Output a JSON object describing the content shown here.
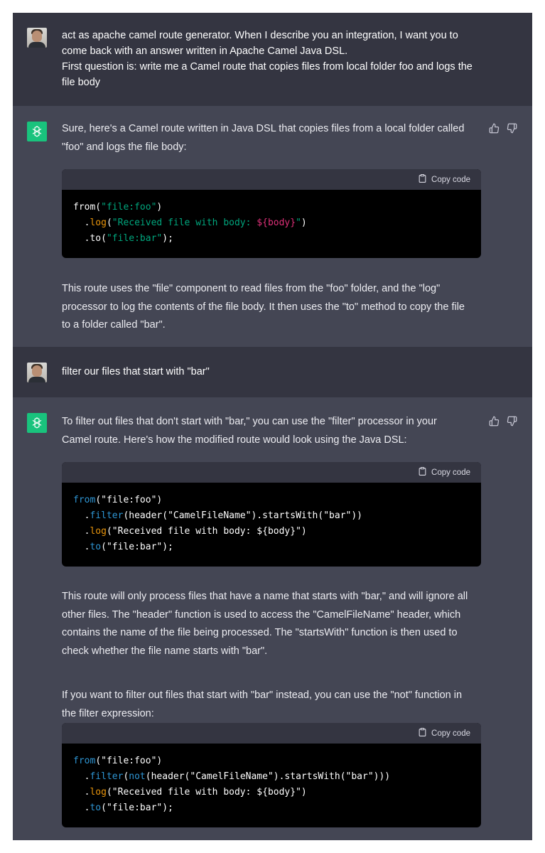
{
  "messages": [
    {
      "role": "user",
      "lines": [
        "act as apache camel route generator. When I describe you an integration, I want you to",
        "come back with an answer written in Apache Camel Java DSL.",
        "First question is: write me a Camel route that copies files from local folder foo and logs the",
        "file body"
      ]
    },
    {
      "role": "assistant",
      "intro_lines": [
        "Sure, here's a Camel route written in Java DSL that copies files from a local folder called",
        "\"foo\" and logs the file body:"
      ],
      "copy_label": "Copy code",
      "code_lines": [
        [
          {
            "t": "from(",
            "c": "plain"
          },
          {
            "t": "\"file:foo\"",
            "c": "str"
          },
          {
            "t": ")",
            "c": "plain"
          }
        ],
        [
          {
            "t": "  .",
            "c": "plain"
          },
          {
            "t": "log",
            "c": "method"
          },
          {
            "t": "(",
            "c": "plain"
          },
          {
            "t": "\"Received file with body: ",
            "c": "str"
          },
          {
            "t": "${body}",
            "c": "var"
          },
          {
            "t": "\"",
            "c": "str"
          },
          {
            "t": ")",
            "c": "plain"
          }
        ],
        [
          {
            "t": "  .to(",
            "c": "plain"
          },
          {
            "t": "\"file:bar\"",
            "c": "str"
          },
          {
            "t": ");",
            "c": "plain"
          }
        ]
      ],
      "outro_lines": [
        "This route uses the \"file\" component to read files from the \"foo\" folder, and the \"log\"",
        "processor to log the contents of the file body. It then uses the \"to\" method to copy the file",
        "to a folder called \"bar\"."
      ]
    },
    {
      "role": "user",
      "lines": [
        "filter our files that start with \"bar\""
      ]
    },
    {
      "role": "assistant",
      "intro_lines": [
        "To filter out files that don't start with \"bar,\" you can use the \"filter\" processor in your",
        "Camel route. Here's how the modified route would look using the Java DSL:"
      ],
      "copy_label": "Copy code",
      "code_lines": [
        [
          {
            "t": "from",
            "c": "blue"
          },
          {
            "t": "(\"file:foo\")",
            "c": "plain"
          }
        ],
        [
          {
            "t": "  .",
            "c": "plain"
          },
          {
            "t": "filter",
            "c": "blue"
          },
          {
            "t": "(header(\"CamelFileName\").startsWith(\"bar\"))",
            "c": "plain"
          }
        ],
        [
          {
            "t": "  .",
            "c": "plain"
          },
          {
            "t": "log",
            "c": "method"
          },
          {
            "t": "(\"Received file with body: ${body}\")",
            "c": "plain"
          }
        ],
        [
          {
            "t": "  .",
            "c": "plain"
          },
          {
            "t": "to",
            "c": "blue"
          },
          {
            "t": "(\"file:bar\");",
            "c": "plain"
          }
        ]
      ],
      "outro_lines": [
        "This route will only process files that have a name that starts with \"bar,\" and will ignore all",
        "other files. The \"header\" function is used to access the \"CamelFileName\" header, which",
        "contains the name of the file being processed. The \"startsWith\" function is then used to",
        "check whether the file name starts with \"bar\"."
      ],
      "outro2_lines": [
        "If you want to filter out files that start with \"bar\" instead, you can use the \"not\" function in",
        "the filter expression:"
      ],
      "copy_label_2": "Copy code",
      "code2_lines": [
        [
          {
            "t": "from",
            "c": "blue"
          },
          {
            "t": "(\"file:foo\")",
            "c": "plain"
          }
        ],
        [
          {
            "t": "  .",
            "c": "plain"
          },
          {
            "t": "filter",
            "c": "blue"
          },
          {
            "t": "(",
            "c": "plain"
          },
          {
            "t": "not",
            "c": "blue"
          },
          {
            "t": "(header(\"CamelFileName\").startsWith(\"bar\")))",
            "c": "plain"
          }
        ],
        [
          {
            "t": "  .",
            "c": "plain"
          },
          {
            "t": "log",
            "c": "method"
          },
          {
            "t": "(\"Received file with body: ${body}\")",
            "c": "plain"
          }
        ],
        [
          {
            "t": "  .",
            "c": "plain"
          },
          {
            "t": "to",
            "c": "blue"
          },
          {
            "t": "(\"file:bar\");",
            "c": "plain"
          }
        ]
      ]
    }
  ],
  "icons": {
    "assistant_avatar": "openai-logo-icon",
    "user_avatar": "user-photo-avatar",
    "thumbs_up": "thumbs-up-icon",
    "thumbs_down": "thumbs-down-icon",
    "copy": "clipboard-icon"
  },
  "colors": {
    "user_bg": "#343541",
    "assistant_bg": "#444654",
    "code_bg": "#000000",
    "code_header_bg": "#343541",
    "assistant_avatar_bg": "#19c37d",
    "string": "#00a67d",
    "method": "#e9950c",
    "variable": "#df3079",
    "keyword_blue": "#2e95d3"
  }
}
